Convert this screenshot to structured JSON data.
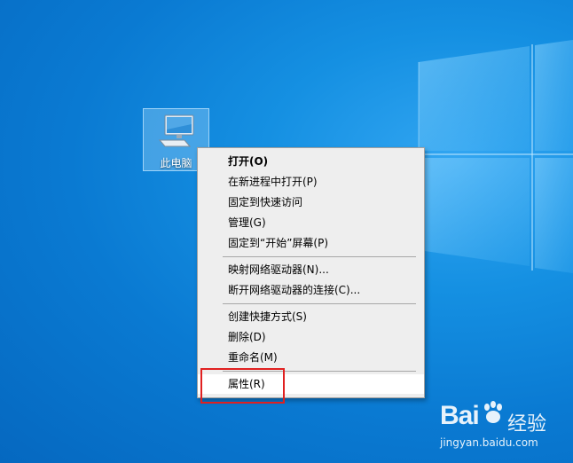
{
  "desktop": {
    "icon_label": "此电脑"
  },
  "context_menu": {
    "items": [
      {
        "label": "打开(O)",
        "bold": true
      },
      {
        "label": "在新进程中打开(P)"
      },
      {
        "label": "固定到快速访问"
      },
      {
        "label": "管理(G)"
      },
      {
        "label": "固定到“开始”屏幕(P)"
      },
      {
        "label": "映射网络驱动器(N)..."
      },
      {
        "label": "断开网络驱动器的连接(C)..."
      },
      {
        "label": "创建快捷方式(S)"
      },
      {
        "label": "删除(D)"
      },
      {
        "label": "重命名(M)"
      },
      {
        "label": "属性(R)",
        "highlighted": true
      }
    ]
  },
  "watermark": {
    "logo_text": "Bai",
    "logo_cn": "经验",
    "url": "jingyan.baidu.com"
  },
  "colors": {
    "desktop_blue": "#0a7ad2",
    "menu_bg": "#eeeeee",
    "highlight_box": "#e02020"
  }
}
